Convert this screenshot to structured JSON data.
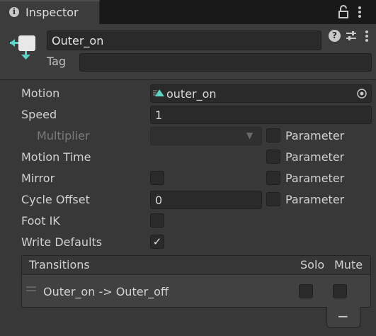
{
  "tab": {
    "title": "Inspector",
    "info_icon": "info-icon",
    "lock_icon": "lock-icon",
    "menu_icon": "kebab-menu-icon"
  },
  "header": {
    "name": "Outer_on",
    "tag_label": "Tag",
    "tag_value": "",
    "state_icon": "animator-state-icon",
    "help_icon": "?",
    "presets_icon": "⇅",
    "menu_icon": "⋮"
  },
  "props": {
    "motion": {
      "label": "Motion",
      "value": "outer_on"
    },
    "speed": {
      "label": "Speed",
      "value": "1"
    },
    "multiplier": {
      "label": "Multiplier",
      "value": "",
      "param": "Parameter"
    },
    "motion_time": {
      "label": "Motion Time",
      "param": "Parameter"
    },
    "mirror": {
      "label": "Mirror",
      "param": "Parameter"
    },
    "cycle_offset": {
      "label": "Cycle Offset",
      "value": "0",
      "param": "Parameter"
    },
    "foot_ik": {
      "label": "Foot IK",
      "checked": false
    },
    "write_defaults": {
      "label": "Write Defaults",
      "checked": true,
      "check_glyph": "✓"
    }
  },
  "transitions": {
    "header": "Transitions",
    "solo": "Solo",
    "mute": "Mute",
    "rows": [
      {
        "label": "Outer_on -> Outer_off",
        "solo": false,
        "mute": false
      }
    ],
    "remove": "−"
  },
  "colors": {
    "accent_teal": "#5fd3c6",
    "panel": "#383838",
    "field": "#2a2a2a"
  }
}
